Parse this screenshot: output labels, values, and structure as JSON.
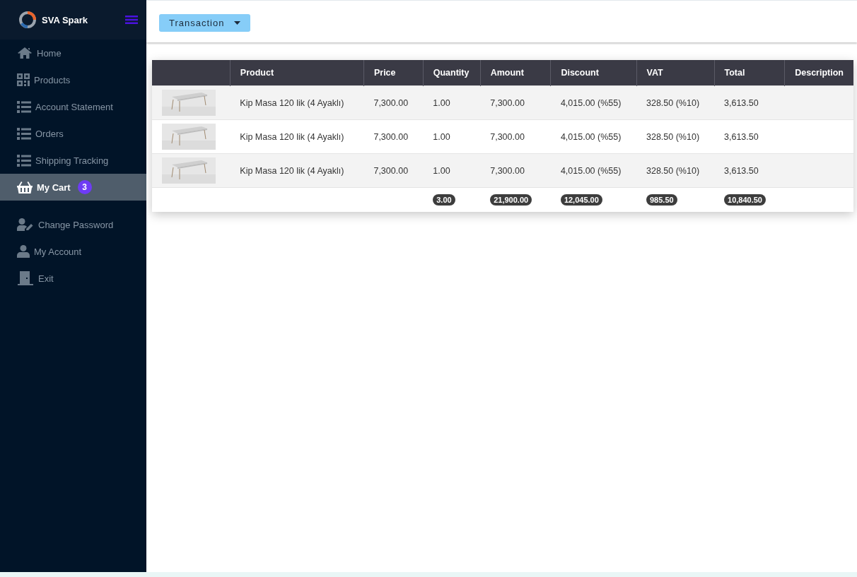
{
  "brand": {
    "name": "SVA Spark"
  },
  "sidebar": {
    "items": [
      {
        "label": "Home",
        "kind": "home",
        "selected": false
      },
      {
        "label": "Products",
        "kind": "grid",
        "selected": false
      },
      {
        "label": "Account Statement",
        "kind": "list",
        "selected": false
      },
      {
        "label": "Orders",
        "kind": "list",
        "selected": false
      },
      {
        "label": "Shipping Tracking",
        "kind": "list",
        "selected": false
      },
      {
        "label": "My Cart",
        "kind": "basket",
        "selected": true,
        "badge": "3"
      }
    ],
    "account_items": [
      {
        "label": "Change Password",
        "kind": "user-edit",
        "selected": false
      },
      {
        "label": "My Account",
        "kind": "user",
        "selected": false
      },
      {
        "label": "Exit",
        "kind": "door",
        "selected": false
      }
    ]
  },
  "toolbar": {
    "button": "Transaction"
  },
  "table": {
    "columns": [
      "",
      "Product",
      "Price",
      "Quantity",
      "Amount",
      "Discount",
      "VAT",
      "Total",
      "Description"
    ],
    "rows": [
      {
        "product": "Kip Masa 120 lik (4 Ayaklı)",
        "price": "7,300.00",
        "quantity": "1.00",
        "amount": "7,300.00",
        "discount": "4,015.00 (%55)",
        "vat": "328.50 (%10)",
        "total": "3,613.50"
      },
      {
        "product": "Kip Masa 120 lik (4 Ayaklı)",
        "price": "7,300.00",
        "quantity": "1.00",
        "amount": "7,300.00",
        "discount": "4,015.00 (%55)",
        "vat": "328.50 (%10)",
        "total": "3,613.50"
      },
      {
        "product": "Kip Masa 120 lik (4 Ayaklı)",
        "price": "7,300.00",
        "quantity": "1.00",
        "amount": "7,300.00",
        "discount": "4,015.00 (%55)",
        "vat": "328.50 (%10)",
        "total": "3,613.50"
      }
    ],
    "totals": {
      "quantity": "3.00",
      "amount": "21,900.00",
      "discount": "12,045.00",
      "vat": "985.50",
      "total": "10,840.50"
    }
  }
}
